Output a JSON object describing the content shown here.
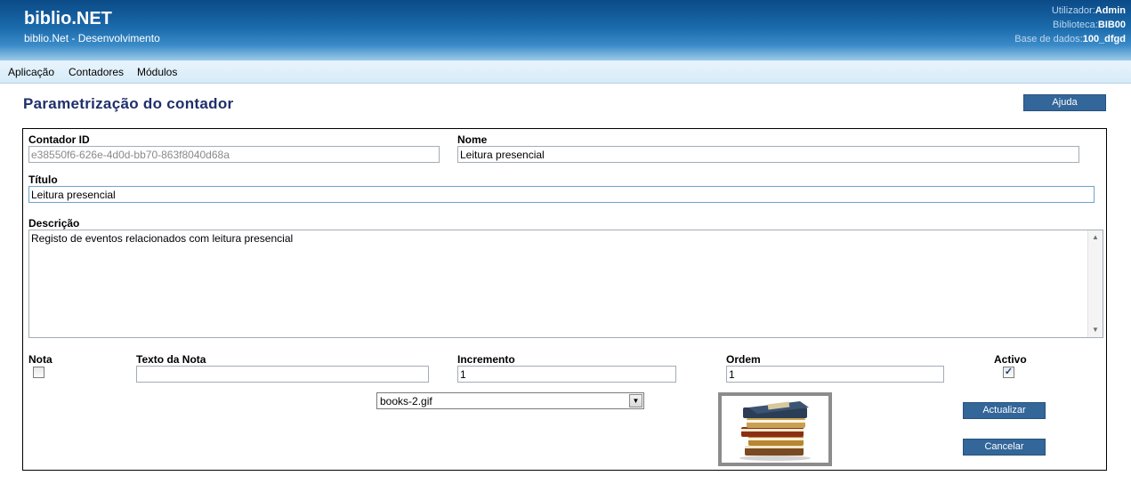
{
  "header": {
    "title": "biblio.NET",
    "subtitle": "biblio.Net - Desenvolvimento",
    "user_label": "Utilizador:",
    "user_value": "Admin",
    "library_label": "Biblioteca:",
    "library_value": "BIB00",
    "db_label": "Base de dados:",
    "db_value": "100_dfgd"
  },
  "menu": {
    "aplicacao": "Aplicação",
    "contadores": "Contadores",
    "modulos": "Módulos"
  },
  "page": {
    "title": "Parametrização do contador",
    "help_button": "Ajuda"
  },
  "form": {
    "contador_id_label": "Contador ID",
    "contador_id_value": "e38550f6-626e-4d0d-bb70-863f8040d68a",
    "nome_label": "Nome",
    "nome_value": "Leitura presencial",
    "titulo_label": "Título",
    "titulo_value": "Leitura presencial",
    "descricao_label": "Descrição",
    "descricao_value": "Registo de eventos relacionados com leitura presencial",
    "nota_label": "Nota",
    "nota_checked": false,
    "texto_nota_label": "Texto da Nota",
    "texto_nota_value": "",
    "incremento_label": "Incremento",
    "incremento_value": "1",
    "ordem_label": "Ordem",
    "ordem_value": "1",
    "activo_label": "Activo",
    "activo_checked": true,
    "activo_mark": "✓",
    "image_select_value": "books-2.gif",
    "image_name": "books-stack-image"
  },
  "actions": {
    "actualizar": "Actualizar",
    "cancelar": "Cancelar"
  },
  "colors": {
    "header_dark": "#0b4a87",
    "button": "#336699",
    "title": "#1f2f6b"
  }
}
